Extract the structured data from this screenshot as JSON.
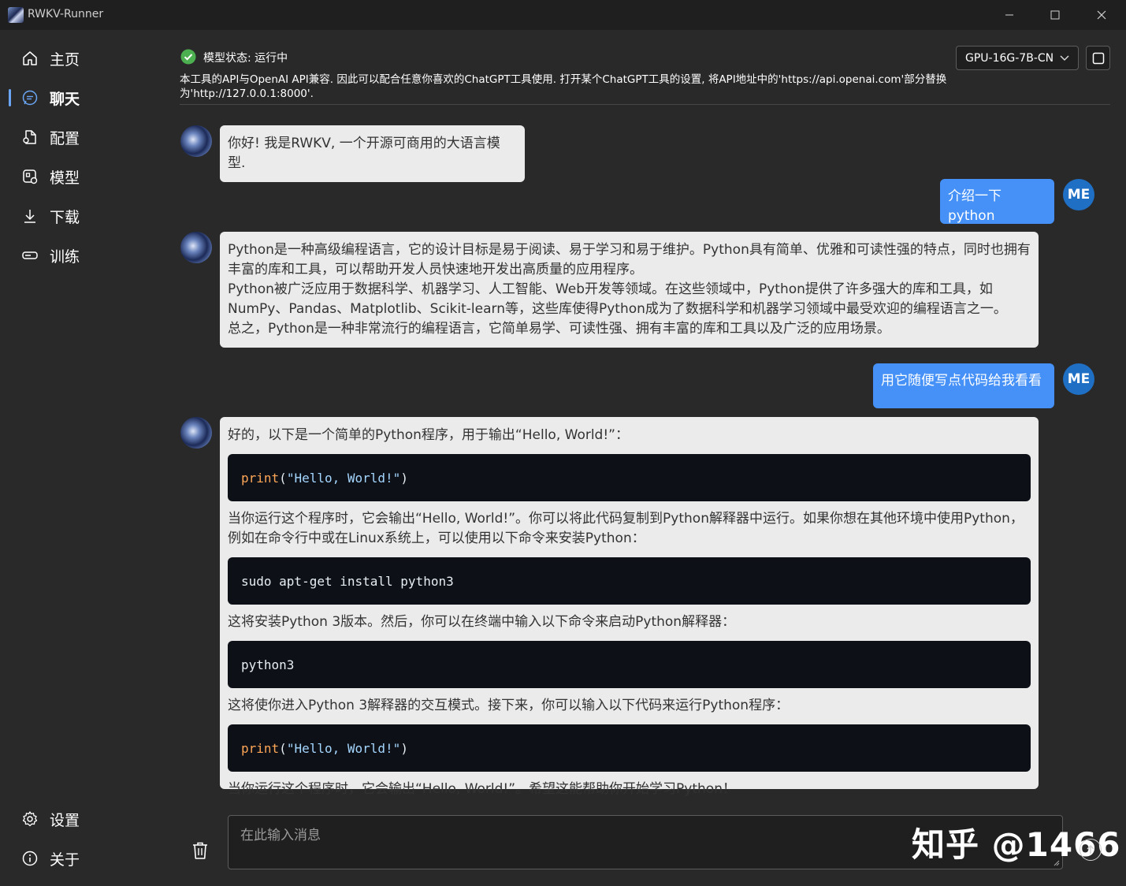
{
  "window": {
    "title": "RWKV-Runner"
  },
  "sidebar": {
    "items": [
      {
        "label": "主页",
        "icon": "home-icon"
      },
      {
        "label": "聊天",
        "icon": "chat-icon",
        "active": true
      },
      {
        "label": "配置",
        "icon": "config-icon"
      },
      {
        "label": "模型",
        "icon": "model-icon"
      },
      {
        "label": "下载",
        "icon": "download-icon"
      },
      {
        "label": "训练",
        "icon": "train-icon"
      }
    ],
    "bottom_items": [
      {
        "label": "设置",
        "icon": "gear-icon"
      },
      {
        "label": "关于",
        "icon": "info-icon"
      }
    ]
  },
  "header": {
    "status": "模型状态: 运行中",
    "status_color": "#4caf50",
    "api_note": "本工具的API与OpenAI API兼容. 因此可以配合任意你喜欢的ChatGPT工具使用. 打开某个ChatGPT工具的设置, 将API地址中的'https://api.openai.com'部分替换为'http://127.0.0.1:8000'.",
    "model_select": "GPU-16G-7B-CN"
  },
  "messages": [
    {
      "role": "ai",
      "paragraphs": [
        "你好! 我是RWKV, 一个开源可商用的大语言模型."
      ]
    },
    {
      "role": "user",
      "avatar": "ME",
      "text": "介绍一下python"
    },
    {
      "role": "ai",
      "paragraphs": [
        "Python是一种高级编程语言，它的设计目标是易于阅读、易于学习和易于维护。Python具有简单、优雅和可读性强的特点，同时也拥有丰富的库和工具，可以帮助开发人员快速地开发出高质量的应用程序。",
        "Python被广泛应用于数据科学、机器学习、人工智能、Web开发等领域。在这些领域中，Python提供了许多强大的库和工具，如NumPy、Pandas、Matplotlib、Scikit-learn等，这些库使得Python成为了数据科学和机器学习领域中最受欢迎的编程语言之一。",
        "总之，Python是一种非常流行的编程语言，它简单易学、可读性强、拥有丰富的库和工具以及广泛的应用场景。"
      ]
    },
    {
      "role": "user",
      "avatar": "ME",
      "text": "用它随便写点代码给我看看"
    },
    {
      "role": "ai",
      "blocks": {
        "p1": "好的，以下是一个简单的Python程序，用于输出“Hello, World!”：",
        "code1_fn": "print",
        "code1_open": "(",
        "code1_str": "\"Hello, World!\"",
        "code1_close": ")",
        "p2": "当你运行这个程序时，它会输出“Hello, World!”。你可以将此代码复制到Python解释器中运行。如果你想在其他环境中使用Python，例如在命令行中或在Linux系统上，可以使用以下命令来安装Python：",
        "code2": "sudo apt-get install python3",
        "p3": "这将安装Python 3版本。然后，你可以在终端中输入以下命令来启动Python解释器：",
        "code3": "python3",
        "p4": "这将使你进入Python 3解释器的交互模式。接下来，你可以输入以下代码来运行Python程序：",
        "code4_fn": "print",
        "code4_open": "(",
        "code4_str": "\"Hello, World!\"",
        "code4_close": ")",
        "p5": "当你运行这个程序时，它会输出“Hello, World!”。希望这能帮助你开始学习Python！"
      }
    }
  ],
  "composer": {
    "placeholder": "在此输入消息"
  },
  "watermark": "知乎 @1466"
}
